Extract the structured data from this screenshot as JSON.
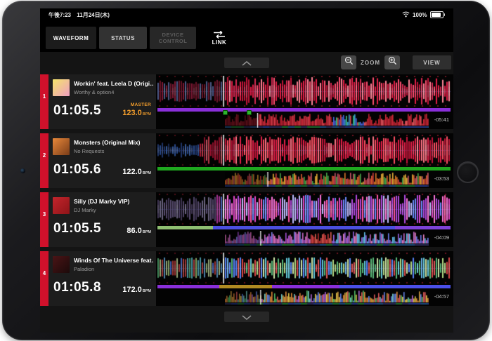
{
  "status_bar": {
    "time": "午後7:23",
    "date": "11月24日(木)",
    "battery": "100%"
  },
  "tabs": [
    {
      "label": "WAVEFORM",
      "state": "active"
    },
    {
      "label": "STATUS",
      "state": "normal"
    },
    {
      "label": "DEVICE CONTROL",
      "state": "disabled"
    },
    {
      "label": "LINK",
      "state": "link"
    }
  ],
  "toolbar": {
    "zoom_label": "ZOOM",
    "view_label": "VIEW"
  },
  "icons": {
    "link_arrows": "swap-arrows",
    "collapse": "chevron-up",
    "expand": "chevron-down",
    "zoom_out": "magnifier-minus",
    "zoom_in": "magnifier-plus",
    "wifi": "wifi",
    "battery": "battery-full"
  },
  "decks": [
    {
      "number": "1",
      "title": "Workin' feat. Leela D (Origi…",
      "artist": "Worthy & option4",
      "time": "01:05.5",
      "master": "MASTER",
      "master_color": "#f59f2c",
      "bpm": "123.0",
      "bpm_unit": "BPM",
      "bpm_color": "#f59f2c",
      "remaining": "-05:41",
      "art_colors": [
        "#f5e56a",
        "#ef9ec0"
      ],
      "progress": [
        [
          "#8a2fd9",
          100
        ]
      ],
      "cues": [
        0,
        0.117
      ],
      "wave": {
        "seed": 11,
        "playhead": 0.225,
        "sections": [
          {
            "u": 0.23,
            "a": 0.78,
            "c": [
              "#8e1a35",
              "#b02448",
              "#6a79b8",
              "#92203f"
            ]
          },
          {
            "u": 1,
            "a": 0.95,
            "c": [
              "#e51e47",
              "#ff4f70",
              "#c01538",
              "#ff8296",
              "#d22850"
            ]
          }
        ],
        "ov_playhead": 0.16,
        "ov_sections": [
          {
            "u": 0.16,
            "c": [
              "#7a1020",
              "#8e1826",
              "#9c2030"
            ]
          },
          {
            "u": 0.52,
            "c": [
              "#d42a3a",
              "#e8404e",
              "#b82030"
            ]
          },
          {
            "u": 0.68,
            "c": [
              "#3f9fd8",
              "#3fc98a",
              "#4a66e0",
              "#d84444"
            ]
          },
          {
            "u": 1,
            "c": [
              "#d42a3a",
              "#ef5560",
              "#c02432"
            ]
          }
        ]
      }
    },
    {
      "number": "2",
      "title": "Monsters (Original Mix)",
      "artist": "No Requests",
      "time": "01:05.6",
      "master": "",
      "master_color": "#f59f2c",
      "bpm": "122.0",
      "bpm_unit": "BPM",
      "bpm_color": "#ffffff",
      "remaining": "-03:53",
      "art_colors": [
        "#e8883a",
        "#7a3c18"
      ],
      "progress": [
        [
          "#1fa81f",
          100
        ]
      ],
      "cues": [],
      "wave": {
        "seed": 22,
        "playhead": 0.225,
        "sections": [
          {
            "u": 0.14,
            "a": 0.5,
            "c": [
              "#2b4a90",
              "#3a66c0",
              "#22386e",
              "#4a7ad0"
            ]
          },
          {
            "u": 1,
            "a": 0.93,
            "c": [
              "#e51e47",
              "#ff4f63",
              "#c01538",
              "#ff7585"
            ]
          }
        ],
        "ov_playhead": 0.21,
        "ov_sections": [
          {
            "u": 1,
            "c": [
              "#e07a28",
              "#d84040",
              "#e8b038",
              "#49a649",
              "#c85868",
              "#e06030"
            ]
          }
        ]
      }
    },
    {
      "number": "3",
      "title": "Silly (DJ Marky VIP)",
      "artist": "DJ Marky",
      "time": "01:05.5",
      "master": "",
      "master_color": "#f59f2c",
      "bpm": "86.0",
      "bpm_unit": "BPM",
      "bpm_color": "#ffffff",
      "remaining": "-04:09",
      "art_colors": [
        "#c4252c",
        "#8e1418"
      ],
      "progress": [
        [
          "#8fbf72",
          19
        ],
        [
          "#4b4fe0",
          62
        ],
        [
          "#7d42d8",
          19
        ]
      ],
      "cues": [],
      "wave": {
        "seed": 33,
        "playhead": 0.225,
        "sections": [
          {
            "u": 0.2,
            "a": 0.82,
            "c": [
              "#6e5e8e",
              "#9488b0",
              "#584a72",
              "#7a6a9a"
            ]
          },
          {
            "u": 1,
            "a": 0.97,
            "c": [
              "#e246c8",
              "#ff74dc",
              "#6e8cff",
              "#c0bcff",
              "#ff56a6",
              "#b24ae0"
            ]
          }
        ],
        "ov_playhead": 0.175,
        "ov_sections": [
          {
            "u": 0.42,
            "c": [
              "#c868c8",
              "#8486f0",
              "#a852d8",
              "#e070c0"
            ]
          },
          {
            "u": 0.52,
            "c": [
              "#d84343",
              "#c03030",
              "#e06050"
            ]
          },
          {
            "u": 1,
            "c": [
              "#c868c8",
              "#64c0ee",
              "#9a64e4",
              "#ef86c8",
              "#6a7ae8"
            ]
          }
        ]
      }
    },
    {
      "number": "4",
      "title": "Winds Of The Universe feat…",
      "artist": "Paladion",
      "time": "01:05.8",
      "master": "",
      "master_color": "#f59f2c",
      "bpm": "172.0",
      "bpm_unit": "BPM",
      "bpm_color": "#ffffff",
      "remaining": "-04:57",
      "art_colors": [
        "#4a1416",
        "#1c0a0a"
      ],
      "progress": [
        [
          "#8a2fd9",
          21
        ],
        [
          "#b08a22",
          18
        ],
        [
          "#8a2fd9",
          23
        ],
        [
          "#4b4fe8",
          38
        ]
      ],
      "cues": [],
      "wave": {
        "seed": 44,
        "playhead": 0.225,
        "sections": [
          {
            "u": 1,
            "a": 0.72,
            "c": [
              "#58b878",
              "#62c8d8",
              "#d84848",
              "#5884f8",
              "#cce4a4",
              "#e05858",
              "#68b0e8",
              "#b0d880"
            ]
          }
        ],
        "ov_playhead": 0.175,
        "ov_sections": [
          {
            "u": 1,
            "c": [
              "#e08838",
              "#e4c84a",
              "#54bc64",
              "#d85858",
              "#6484e4",
              "#b468d8",
              "#74ccc4",
              "#d8a040"
            ]
          }
        ]
      }
    }
  ]
}
